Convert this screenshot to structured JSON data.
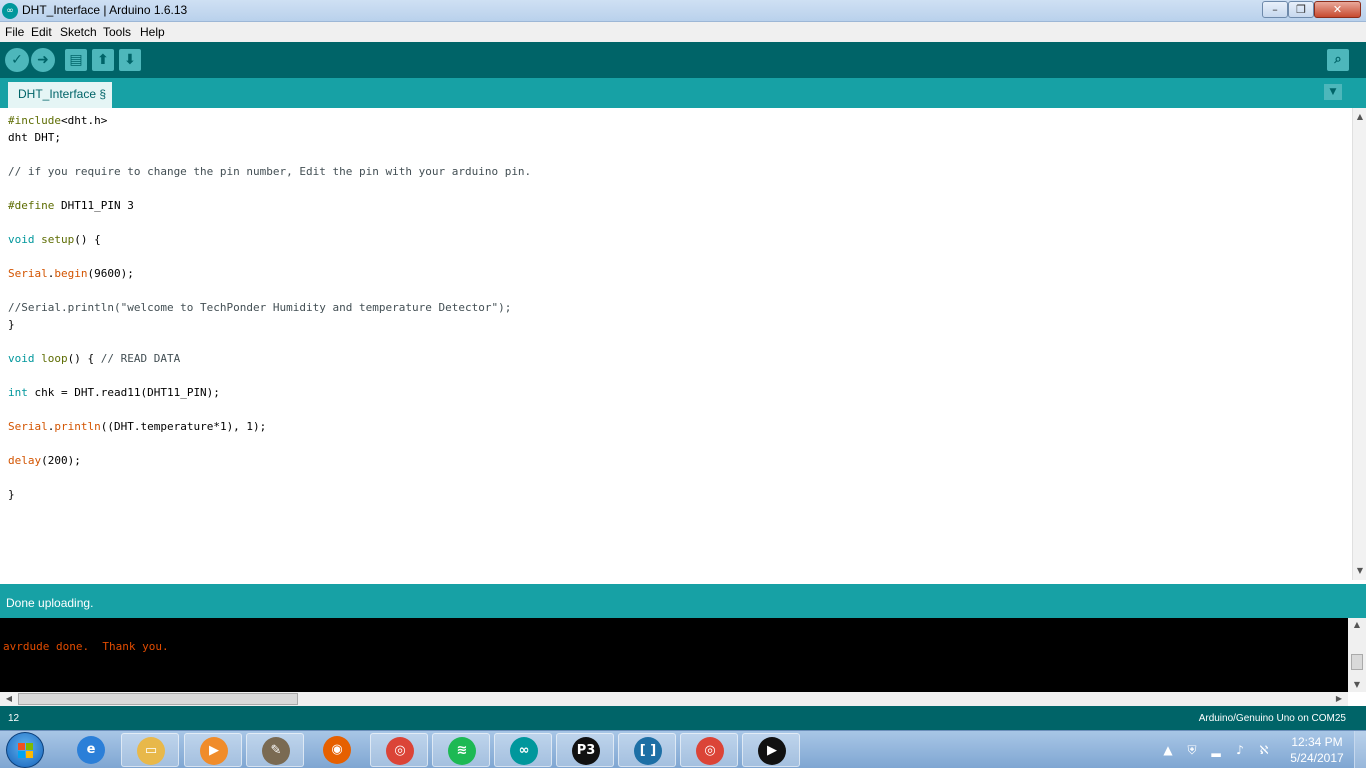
{
  "window": {
    "title": "DHT_Interface | Arduino 1.6.13",
    "app_icon": "arduino-icon",
    "minimize": "–",
    "maximize": "❐",
    "close": "✕"
  },
  "menu": [
    "File",
    "Edit",
    "Sketch",
    "Tools",
    "Help"
  ],
  "toolbar": {
    "buttons": [
      {
        "name": "verify",
        "icon": "checkmark-icon",
        "glyph": "✓"
      },
      {
        "name": "upload",
        "icon": "arrow-right-icon",
        "glyph": "➜"
      },
      {
        "name": "new",
        "icon": "new-file-icon",
        "glyph": "▤"
      },
      {
        "name": "open",
        "icon": "arrow-up-icon",
        "glyph": "⬆"
      },
      {
        "name": "save",
        "icon": "arrow-down-icon",
        "glyph": "⬇"
      }
    ],
    "serial_monitor": {
      "icon": "magnifier-icon",
      "glyph": "⌕"
    }
  },
  "tab": {
    "label": "DHT_Interface §",
    "menu_glyph": "▼"
  },
  "code_lines": [
    [
      [
        "kw-pre",
        "#include"
      ],
      [
        "",
        "<dht.h>"
      ]
    ],
    [
      [
        "",
        "dht DHT;"
      ]
    ],
    [],
    [
      [
        "cmt",
        "// if you require to change the pin number, Edit the pin with your arduino pin."
      ]
    ],
    [],
    [
      [
        "kw-pre",
        "#define"
      ],
      [
        "",
        " DHT11_PIN 3"
      ]
    ],
    [],
    [
      [
        "kw-type",
        "void"
      ],
      [
        "",
        " "
      ],
      [
        "kw-fn",
        "setup"
      ],
      [
        "",
        "() {"
      ]
    ],
    [],
    [
      [
        "kw-obj",
        "Serial"
      ],
      [
        "",
        "."
      ],
      [
        "kw-obj",
        "begin"
      ],
      [
        "",
        "(9600);"
      ]
    ],
    [],
    [
      [
        "cmt",
        "//Serial.println(\"welcome to TechPonder Humidity and temperature Detector\");"
      ]
    ],
    [
      [
        "",
        "}"
      ]
    ],
    [],
    [
      [
        "kw-type",
        "void"
      ],
      [
        "",
        " "
      ],
      [
        "kw-fn",
        "loop"
      ],
      [
        "",
        "() { "
      ],
      [
        "cmt",
        "// READ DATA"
      ]
    ],
    [],
    [
      [
        "kw-type",
        "int"
      ],
      [
        "",
        " chk = DHT.read11(DHT11_PIN);"
      ]
    ],
    [],
    [
      [
        "kw-obj",
        "Serial"
      ],
      [
        "",
        "."
      ],
      [
        "kw-obj",
        "println"
      ],
      [
        "",
        "((DHT.temperature*1), 1);"
      ]
    ],
    [],
    [
      [
        "kw-obj",
        "delay"
      ],
      [
        "",
        "(200);"
      ]
    ],
    [],
    [
      [
        "",
        "}"
      ]
    ]
  ],
  "status": {
    "message": "Done uploading."
  },
  "console": {
    "line": "avrdude done.  Thank you."
  },
  "footer": {
    "line_number": "12",
    "board": "Arduino/Genuino Uno on COM25"
  },
  "taskbar": {
    "start_icon": "windows-start-icon",
    "items": [
      {
        "icon": "internet-explorer-icon",
        "glyph": "e",
        "color": "#2b7fd8",
        "active": false
      },
      {
        "icon": "file-explorer-icon",
        "glyph": "▭",
        "color": "#e8b84a",
        "active": true
      },
      {
        "icon": "media-player-icon",
        "glyph": "▶",
        "color": "#f08c2a",
        "active": true
      },
      {
        "icon": "gimp-icon",
        "glyph": "✎",
        "color": "#7a6a52",
        "active": true
      },
      {
        "icon": "firefox-icon",
        "glyph": "◉",
        "color": "#e66000",
        "active": false
      },
      {
        "icon": "chrome-icon",
        "glyph": "◎",
        "color": "#db4437",
        "active": true
      },
      {
        "icon": "spotify-icon",
        "glyph": "≋",
        "color": "#1db954",
        "active": true
      },
      {
        "icon": "arduino-icon",
        "glyph": "∞",
        "color": "#00979c",
        "active": true
      },
      {
        "icon": "p3-icon",
        "glyph": "P3",
        "color": "#111111",
        "active": true
      },
      {
        "icon": "brackets-icon",
        "glyph": "[ ]",
        "color": "#1d6fa5",
        "active": true
      },
      {
        "icon": "chrome-icon",
        "glyph": "◎",
        "color": "#db4437",
        "active": true
      },
      {
        "icon": "media-play-icon",
        "glyph": "▶",
        "color": "#111111",
        "active": true
      }
    ],
    "tray_icons": [
      {
        "icon": "show-hidden-icons-icon",
        "glyph": "▲"
      },
      {
        "icon": "antivirus-icon",
        "glyph": "⛨"
      },
      {
        "icon": "network-signal-icon",
        "glyph": "▂"
      },
      {
        "icon": "volume-icon",
        "glyph": "♪"
      },
      {
        "icon": "acrobat-icon",
        "glyph": "ℵ"
      }
    ],
    "clock": {
      "time": "12:34 PM",
      "date": "5/24/2017"
    }
  }
}
